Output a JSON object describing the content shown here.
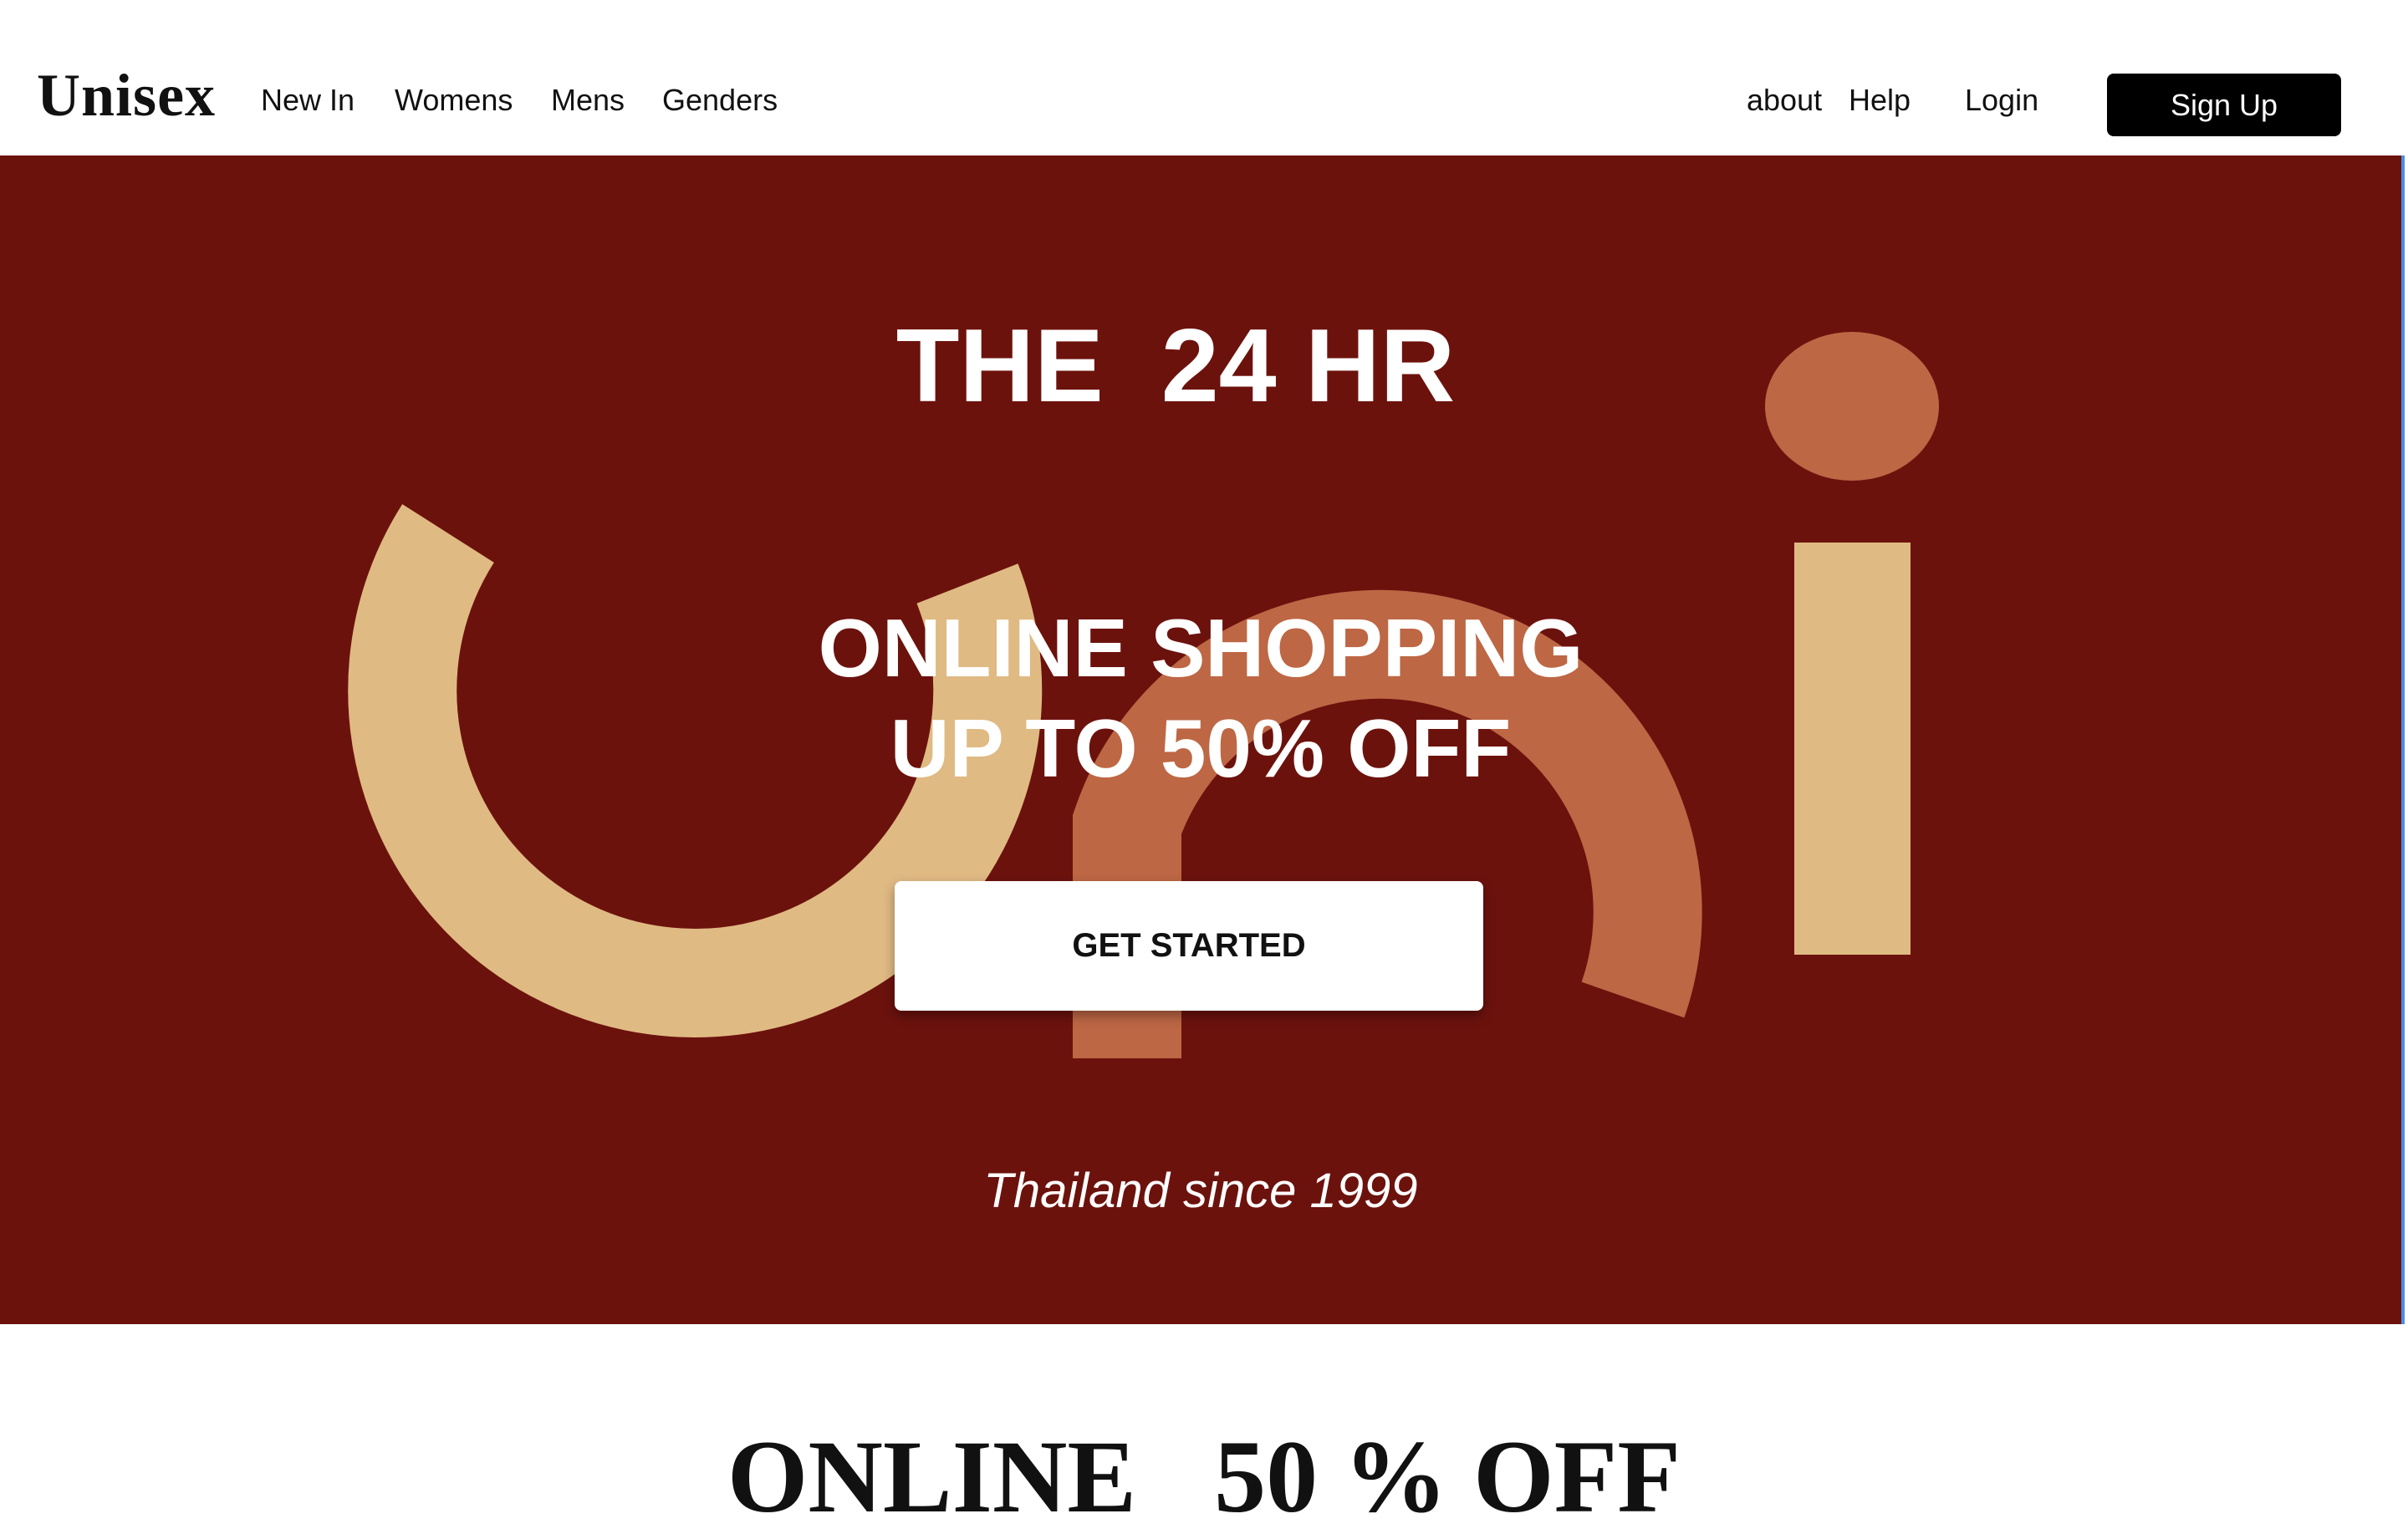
{
  "header": {
    "logo": "Unisex",
    "nav_left": [
      {
        "label": "New In"
      },
      {
        "label": "Womens"
      },
      {
        "label": "Mens"
      },
      {
        "label": "Genders"
      }
    ],
    "nav_right": {
      "about": "about",
      "help": "Help",
      "login": "Login",
      "signup": "Sign Up"
    }
  },
  "hero": {
    "title": "THE  24 HR",
    "line1": "ONLINE SHOPPING",
    "line2": "UP TO 50% OFF",
    "cta": "GET STARTED",
    "tagline": "Thailand since 1999",
    "colors": {
      "background": "#6c120d",
      "tan": "#e0ba83",
      "terracotta": "#bd6744"
    }
  },
  "section": {
    "title": "ONLINE   50 % OFF"
  }
}
